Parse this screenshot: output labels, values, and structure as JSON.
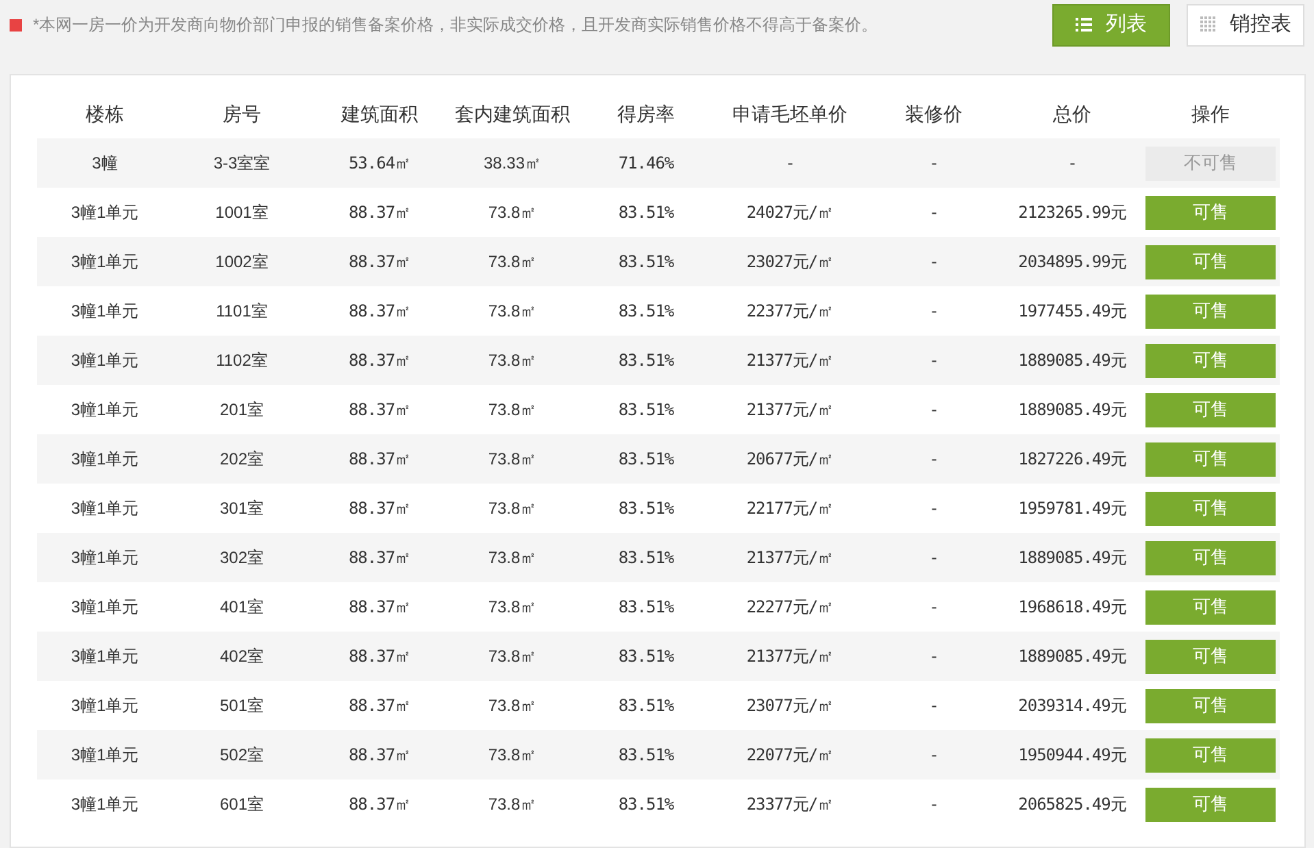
{
  "notice": "*本网一房一价为开发商向物价部门申报的销售备案价格，非实际成交价格，且开发商实际销售价格不得高于备案价。",
  "view_tabs": [
    {
      "label": "列表",
      "selected": true,
      "kind": "list"
    },
    {
      "label": "销控表",
      "selected": false,
      "kind": "grid"
    }
  ],
  "table": {
    "columns": [
      "楼栋",
      "房号",
      "建筑面积",
      "套内建筑面积",
      "得房率",
      "申请毛坯单价",
      "装修价",
      "总价",
      "操作"
    ],
    "rows": [
      {
        "cells": [
          "3幢",
          "3-3室室",
          "53.64㎡",
          "38.33㎡",
          "71.46%",
          "-",
          "-",
          "-"
        ],
        "action": "不可售",
        "available": false
      },
      {
        "cells": [
          "3幢1单元",
          "1001室",
          "88.37㎡",
          "73.8㎡",
          "83.51%",
          "24027元/㎡",
          "-",
          "2123265.99元"
        ],
        "action": "可售",
        "available": true
      },
      {
        "cells": [
          "3幢1单元",
          "1002室",
          "88.37㎡",
          "73.8㎡",
          "83.51%",
          "23027元/㎡",
          "-",
          "2034895.99元"
        ],
        "action": "可售",
        "available": true
      },
      {
        "cells": [
          "3幢1单元",
          "1101室",
          "88.37㎡",
          "73.8㎡",
          "83.51%",
          "22377元/㎡",
          "-",
          "1977455.49元"
        ],
        "action": "可售",
        "available": true
      },
      {
        "cells": [
          "3幢1单元",
          "1102室",
          "88.37㎡",
          "73.8㎡",
          "83.51%",
          "21377元/㎡",
          "-",
          "1889085.49元"
        ],
        "action": "可售",
        "available": true
      },
      {
        "cells": [
          "3幢1单元",
          "201室",
          "88.37㎡",
          "73.8㎡",
          "83.51%",
          "21377元/㎡",
          "-",
          "1889085.49元"
        ],
        "action": "可售",
        "available": true
      },
      {
        "cells": [
          "3幢1单元",
          "202室",
          "88.37㎡",
          "73.8㎡",
          "83.51%",
          "20677元/㎡",
          "-",
          "1827226.49元"
        ],
        "action": "可售",
        "available": true
      },
      {
        "cells": [
          "3幢1单元",
          "301室",
          "88.37㎡",
          "73.8㎡",
          "83.51%",
          "22177元/㎡",
          "-",
          "1959781.49元"
        ],
        "action": "可售",
        "available": true
      },
      {
        "cells": [
          "3幢1单元",
          "302室",
          "88.37㎡",
          "73.8㎡",
          "83.51%",
          "21377元/㎡",
          "-",
          "1889085.49元"
        ],
        "action": "可售",
        "available": true
      },
      {
        "cells": [
          "3幢1单元",
          "401室",
          "88.37㎡",
          "73.8㎡",
          "83.51%",
          "22277元/㎡",
          "-",
          "1968618.49元"
        ],
        "action": "可售",
        "available": true
      },
      {
        "cells": [
          "3幢1单元",
          "402室",
          "88.37㎡",
          "73.8㎡",
          "83.51%",
          "21377元/㎡",
          "-",
          "1889085.49元"
        ],
        "action": "可售",
        "available": true
      },
      {
        "cells": [
          "3幢1单元",
          "501室",
          "88.37㎡",
          "73.8㎡",
          "83.51%",
          "23077元/㎡",
          "-",
          "2039314.49元"
        ],
        "action": "可售",
        "available": true
      },
      {
        "cells": [
          "3幢1单元",
          "502室",
          "88.37㎡",
          "73.8㎡",
          "83.51%",
          "22077元/㎡",
          "-",
          "1950944.49元"
        ],
        "action": "可售",
        "available": true
      },
      {
        "cells": [
          "3幢1单元",
          "601室",
          "88.37㎡",
          "73.8㎡",
          "83.51%",
          "23377元/㎡",
          "-",
          "2065825.49元"
        ],
        "action": "可售",
        "available": true
      }
    ]
  }
}
